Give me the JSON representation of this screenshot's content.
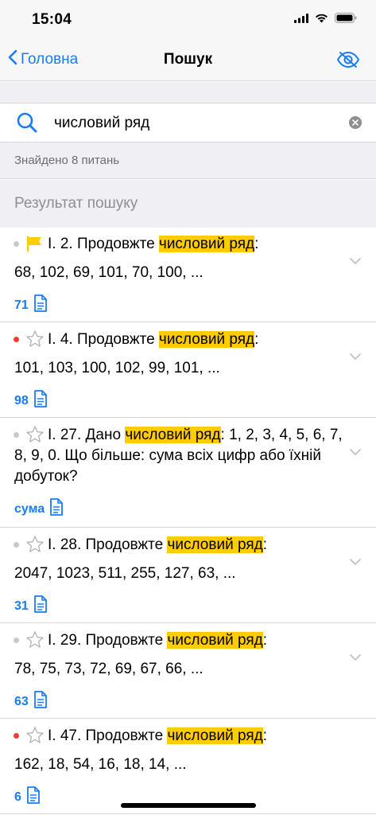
{
  "status": {
    "time": "15:04"
  },
  "nav": {
    "back_label": "Головна",
    "title": "Пошук"
  },
  "search": {
    "value": "числовий ряд",
    "placeholder": ""
  },
  "found_text": "Знайдено 8 питань",
  "section_title": "Результат пошуку",
  "colors": {
    "accent": "#1a7cf5",
    "highlight": "#ffcc00",
    "dot_red": "#ff3b30",
    "dot_gray": "#c7c7cc",
    "flag": "#ffcc00"
  },
  "results": [
    {
      "prefix": "І. 2. Продовжте ",
      "highlight": "числовий ряд",
      "suffix": ":",
      "line2": "68, 102, 69, 101, 70, 100, ...",
      "answer": "71",
      "mark": "flag-icon",
      "dot": "gray"
    },
    {
      "prefix": "І. 4. Продовжте ",
      "highlight": "числовий ряд",
      "suffix": ":",
      "line2": "101, 103, 100, 102, 99, 101, ...",
      "answer": "98",
      "mark": "star-icon",
      "dot": "red"
    },
    {
      "prefix": "І. 27. Дано ",
      "highlight": "числовий ряд",
      "suffix": ": 1, 2, 3, 4, 5, 6, 7,",
      "line2": "8, 9, 0. Що більше: сума всіх цифр або їхній",
      "line3": "добуток?",
      "answer": "сума",
      "mark": "star-icon",
      "dot": "gray"
    },
    {
      "prefix": "І. 28. Продовжте ",
      "highlight": "числовий ряд",
      "suffix": ":",
      "line2": "2047, 1023, 511, 255, 127, 63, ...",
      "answer": "31",
      "mark": "star-icon",
      "dot": "gray"
    },
    {
      "prefix": "І. 29. Продовжте ",
      "highlight": "числовий ряд",
      "suffix": ":",
      "line2": "78, 75, 73, 72, 69, 67, 66, ...",
      "answer": "63",
      "mark": "star-icon",
      "dot": "gray"
    },
    {
      "prefix": "І. 47. Продовжте ",
      "highlight": "числовий ряд",
      "suffix": ":",
      "line2": "162, 18, 54, 16, 18, 14, ...",
      "answer": "6",
      "mark": "star-icon",
      "dot": "red"
    }
  ]
}
